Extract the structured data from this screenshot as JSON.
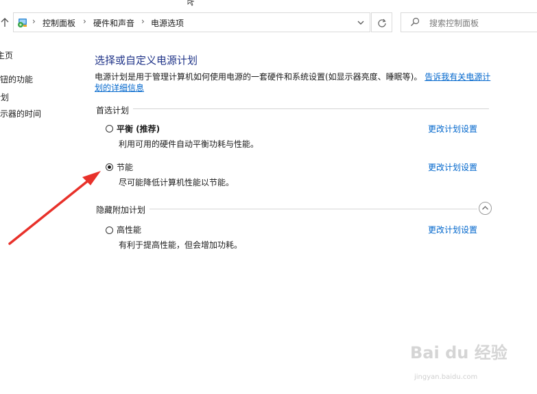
{
  "breadcrumb": {
    "items": [
      "控制面板",
      "硬件和声音",
      "电源选项"
    ],
    "separator": "›"
  },
  "search": {
    "placeholder": "搜索控制面板"
  },
  "nav": {
    "items": [
      "主页",
      "按钮的功能",
      "计划",
      "显示器的时间"
    ]
  },
  "main": {
    "title": "选择或自定义电源计划",
    "description": "电源计划是用于管理计算机如何使用电源的一套硬件和系统设置(如显示器亮度、睡眠等)。",
    "description_link": "告诉我有关电源计划的详细信息",
    "preferred_heading": "首选计划",
    "hidden_heading": "隐藏附加计划",
    "change_link": "更改计划设置",
    "plans": [
      {
        "name": "平衡 (推荐)",
        "desc": "利用可用的硬件自动平衡功耗与性能。",
        "selected": false
      },
      {
        "name": "节能",
        "desc": "尽可能降低计算机性能以节能。",
        "selected": true
      },
      {
        "name": "高性能",
        "desc": "有利于提高性能，但会增加功耗。",
        "selected": false
      }
    ]
  },
  "watermark": {
    "logo": "Bai du 经验",
    "url": "jingyan.baidu.com"
  },
  "colors": {
    "link": "#0066cc",
    "title": "#1e3287",
    "arrow": "#e8312a"
  }
}
